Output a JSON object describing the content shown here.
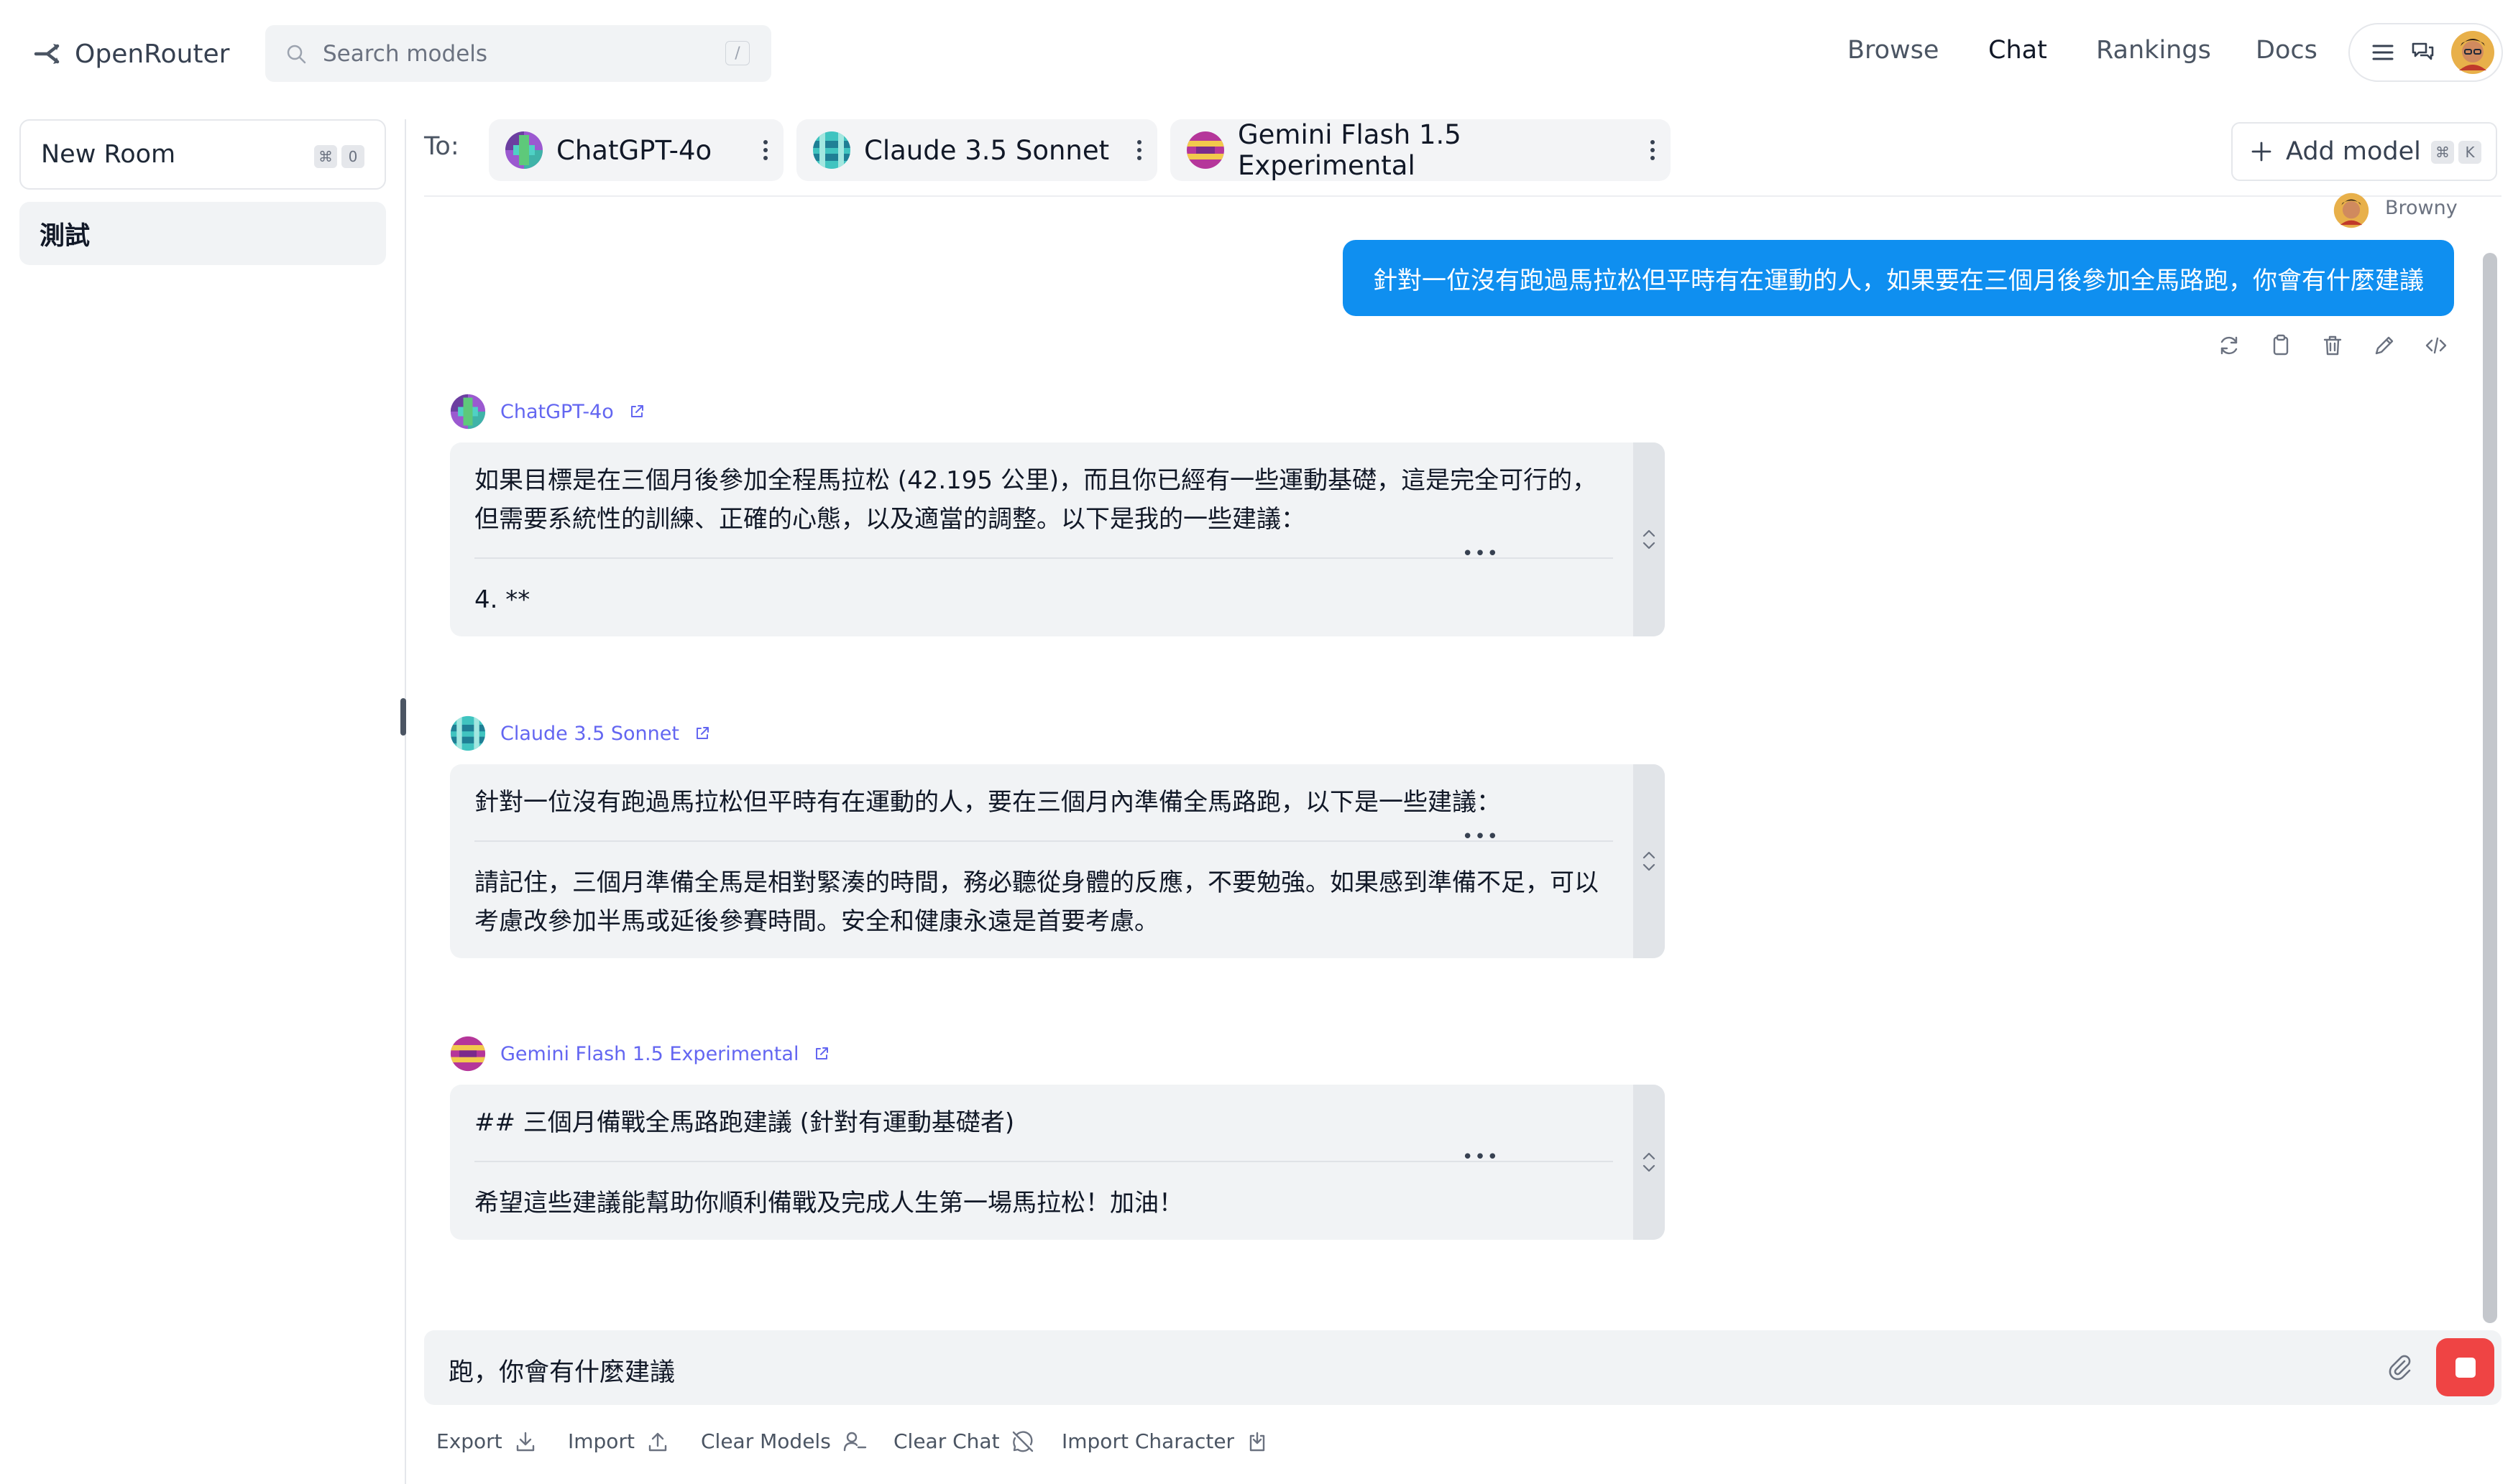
{
  "header": {
    "logo_text": "OpenRouter",
    "search_placeholder": "Search models",
    "search_shortcut": "/",
    "nav": [
      "Browse",
      "Chat",
      "Rankings",
      "Docs"
    ],
    "active_nav": "Chat"
  },
  "sidebar": {
    "new_room_label": "New Room",
    "new_room_shortcut": [
      "⌘",
      "0"
    ],
    "rooms": [
      "測試"
    ]
  },
  "model_bar": {
    "to_label": "To:",
    "models": [
      "ChatGPT-4o",
      "Claude 3.5 Sonnet",
      "Gemini Flash 1.5 Experimental"
    ],
    "add_model_label": "Add model",
    "add_model_shortcut": [
      "⌘",
      "K"
    ]
  },
  "user_message": {
    "author": "Browny",
    "text": "針對一位沒有跑過馬拉松但平時有在運動的人，如果要在三個月後參加全馬路跑，你會有什麼建議"
  },
  "responses": [
    {
      "model": "ChatGPT-4o",
      "text_top": "如果目標是在三個月後參加全程馬拉松 (42.195 公里)，而且你已經有一些運動基礎，這是完全可行的，但需要系統性的訓練、正確的心態，以及適當的調整。以下是我的一些建議：",
      "text_bottom": "4. **"
    },
    {
      "model": "Claude 3.5 Sonnet",
      "text_top": "針對一位沒有跑過馬拉松但平時有在運動的人，要在三個月內準備全馬路跑，以下是一些建議：",
      "text_bottom": "請記住，三個月準備全馬是相對緊湊的時間，務必聽從身體的反應，不要勉強。如果感到準備不足，可以考慮改參加半馬或延後參賽時間。安全和健康永遠是首要考慮。"
    },
    {
      "model": "Gemini Flash 1.5 Experimental",
      "text_top": "## 三個月備戰全馬路跑建議 (針對有運動基礎者)",
      "text_bottom": "希望這些建議能幫助你順利備戰及完成人生第一場馬拉松！加油！"
    }
  ],
  "composer": {
    "value": "跑，你會有什麼建議"
  },
  "toolbar": {
    "export": "Export",
    "import": "Import",
    "clear_models": "Clear Models",
    "clear_chat": "Clear Chat",
    "import_character": "Import Character"
  },
  "colors": {
    "user_bubble": "#0f8ff0",
    "model_link": "#6366f1",
    "stop_button": "#ef4444"
  }
}
